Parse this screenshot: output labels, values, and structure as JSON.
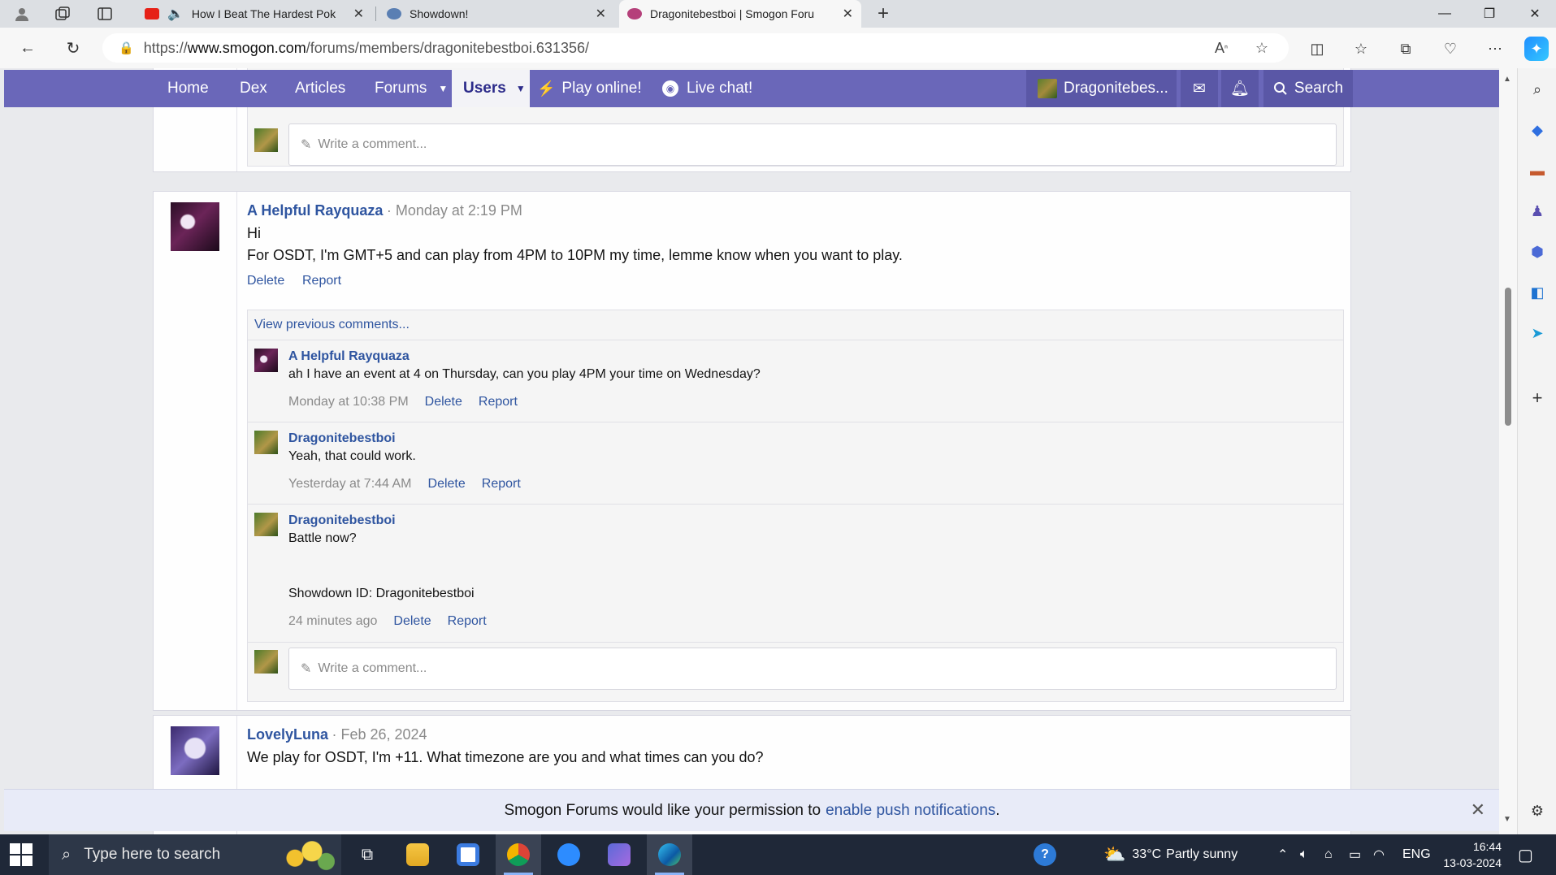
{
  "browser": {
    "tabs": [
      {
        "title": "How I Beat The Hardest Pok",
        "favicon_color": "#e62117"
      },
      {
        "title": "Showdown!",
        "favicon_color": "#5a7fb3"
      },
      {
        "title": "Dragonitebestboi | Smogon Foru",
        "favicon_color": "#b5407a"
      }
    ],
    "url_prefix": "https://",
    "url_host": "www.smogon.com",
    "url_path": "/forums/members/dragonitebestboi.631356/"
  },
  "nav": {
    "home": "Home",
    "dex": "Dex",
    "articles": "Articles",
    "forums": "Forums",
    "users": "Users",
    "play_online": "Play online!",
    "live_chat": "Live chat!",
    "account": "Dragonitebes...",
    "search": "Search"
  },
  "top_comment_placeholder": "Write a comment...",
  "post1": {
    "author": "A Helpful Rayquaza",
    "time": "Monday at 2:19 PM",
    "line1": "Hi",
    "line2": "For OSDT, I'm GMT+5 and can play from 4PM to 10PM my time, lemme know when you want to play.",
    "delete": "Delete",
    "report": "Report",
    "view_previous": "View previous comments...",
    "comments": [
      {
        "author": "A Helpful Rayquaza",
        "text": "ah I have an event at 4 on Thursday, can you play 4PM your time on Wednesday?",
        "time": "Monday at 10:38 PM",
        "delete": "Delete",
        "report": "Report"
      },
      {
        "author": "Dragonitebestboi",
        "text": "Yeah, that could work.",
        "time": "Yesterday at 7:44 AM",
        "delete": "Delete",
        "report": "Report"
      },
      {
        "author": "Dragonitebestboi",
        "text": "Battle now?",
        "text2": "Showdown ID: Dragonitebestboi",
        "time": "24 minutes ago",
        "delete": "Delete",
        "report": "Report"
      }
    ],
    "comment_placeholder": "Write a comment..."
  },
  "post2": {
    "author": "LovelyLuna",
    "time": "Feb 26, 2024",
    "text": "We play for OSDT, I'm +11. What timezone are you and what times can you do?"
  },
  "push": {
    "text": "Smogon Forums would like your permission to",
    "link": "enable push notifications",
    "end": "."
  },
  "taskbar": {
    "search_placeholder": "Type here to search",
    "weather_temp": "33°C",
    "weather_desc": "Partly sunny",
    "lang": "ENG",
    "time": "16:44",
    "date": "13-03-2024"
  },
  "colors": {
    "nav_bg": "#6a67b9",
    "link": "#2f55a0"
  }
}
